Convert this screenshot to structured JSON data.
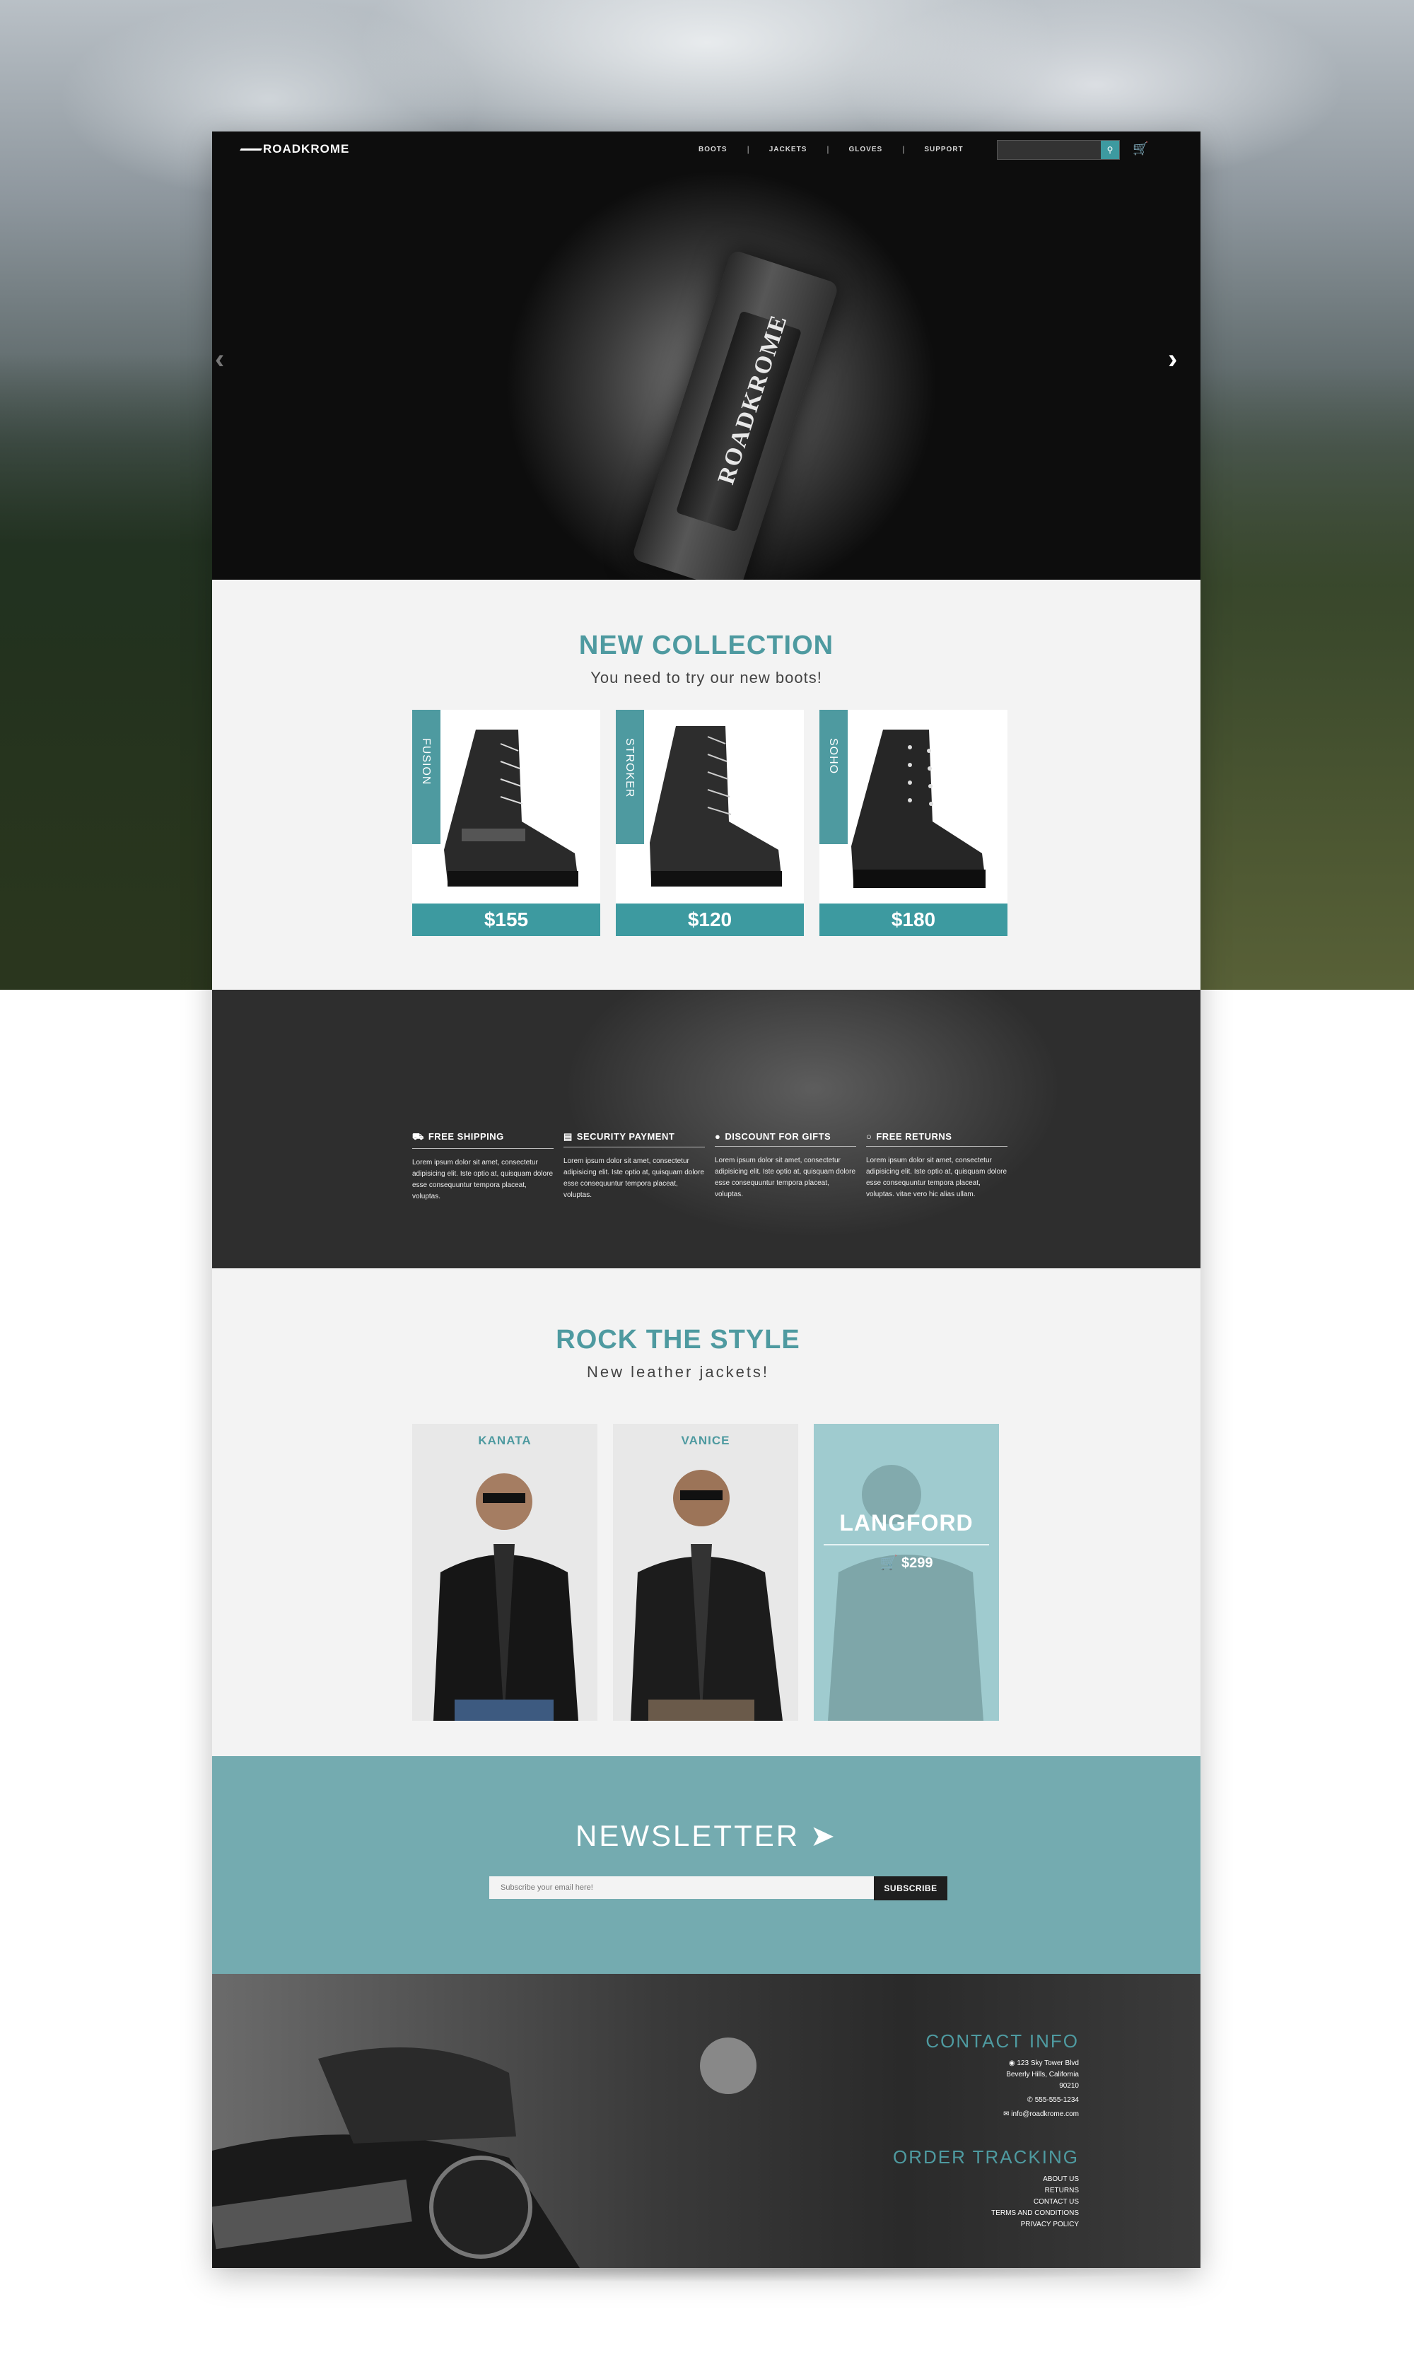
{
  "brand": "ROADKROME",
  "nav": {
    "items": [
      "BOOTS",
      "JACKETS",
      "GLOVES",
      "SUPPORT"
    ],
    "search_placeholder": ""
  },
  "hero": {
    "brand_on_strap": "ROADKROME"
  },
  "new_collection": {
    "title": "NEW COLLECTION",
    "subtitle": "You need to try our new boots!",
    "products": [
      {
        "name": "FUSION",
        "price": "$155"
      },
      {
        "name": "STROKER",
        "price": "$120"
      },
      {
        "name": "SOHO",
        "price": "$180"
      }
    ]
  },
  "features": [
    {
      "title": "FREE SHIPPING",
      "text": "Lorem ipsum dolor sit amet, consectetur adipisicing elit. Iste optio at, quisquam dolore esse consequuntur tempora placeat, voluptas."
    },
    {
      "title": "SECURITY PAYMENT",
      "text": "Lorem ipsum dolor sit amet, consectetur adipisicing elit. Iste optio at, quisquam dolore esse consequuntur tempora placeat, voluptas."
    },
    {
      "title": "DISCOUNT FOR GIFTS",
      "text": "Lorem ipsum dolor sit amet, consectetur adipisicing elit. Iste optio at, quisquam dolore esse consequuntur tempora placeat, voluptas."
    },
    {
      "title": "FREE RETURNS",
      "text": "Lorem ipsum dolor sit amet, consectetur adipisicing elit. Iste optio at, quisquam dolore esse consequuntur tempora placeat, voluptas. vitae vero hic alias ullam."
    }
  ],
  "rock": {
    "title": "ROCK THE STYLE",
    "subtitle": "New leather jackets!",
    "jackets": [
      {
        "name": "KANATA"
      },
      {
        "name": "VANICE"
      },
      {
        "name": "LANGFORD",
        "price": "$299"
      }
    ]
  },
  "newsletter": {
    "title": "NEWSLETTER",
    "placeholder": "Subscribe your email here!",
    "button": "SUBSCRIBE"
  },
  "footer": {
    "contact_title": "CONTACT INFO",
    "address_1": "123 Sky Tower Blvd",
    "address_2": "Beverly Hills, California",
    "address_3": "90210",
    "phone": "555-555-1234",
    "email": "info@roadkrome.com",
    "tracking_title": "ORDER TRACKING",
    "links": [
      "ABOUT US",
      "RETURNS",
      "CONTACT US",
      "TERMS AND CONDITIONS",
      "PRIVACY POLICY"
    ]
  },
  "colors": {
    "accent": "#4e9aa0",
    "newsletter_bg": "#74abb0"
  },
  "icons": [
    "search-icon",
    "cart-icon",
    "chevron-left-icon",
    "chevron-right-icon",
    "truck-icon",
    "card-icon",
    "gift-icon",
    "motorcycle-icon",
    "paper-plane-icon",
    "map-pin-icon",
    "phone-icon",
    "mail-icon"
  ]
}
